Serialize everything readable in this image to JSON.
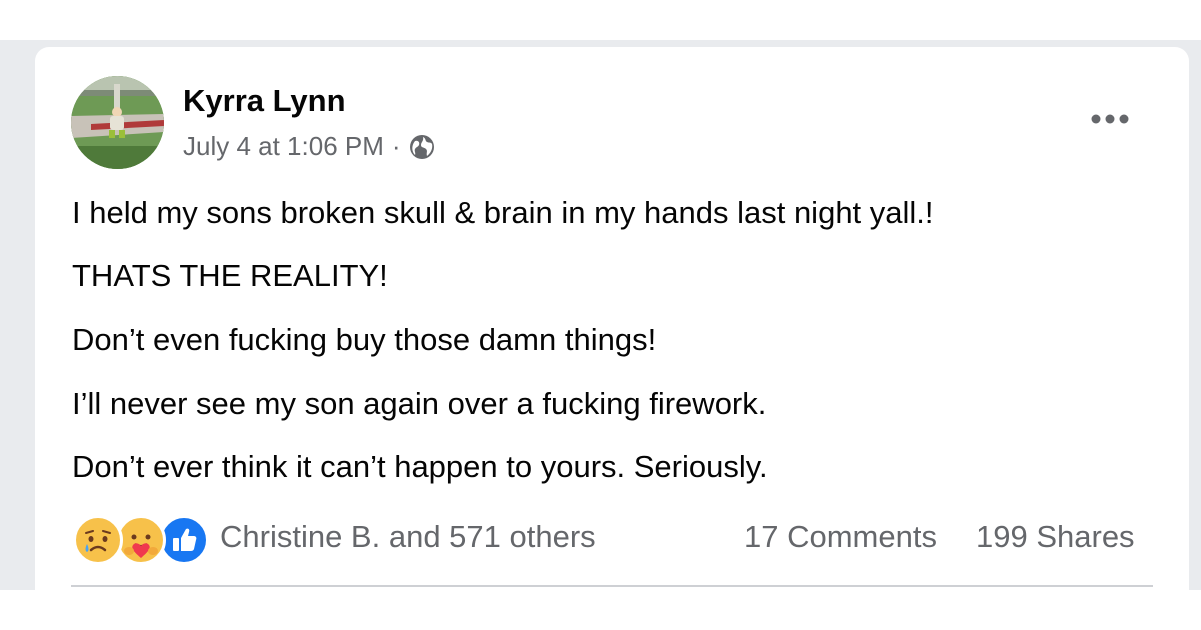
{
  "post": {
    "author": "Kyrra Lynn",
    "timestamp": "July 4 at 1:06 PM",
    "separator": "·",
    "privacy_icon": "globe-icon",
    "more_icon": "more-options-icon",
    "lines": [
      "I held my sons broken skull & brain in my hands last night yall.!",
      "THATS THE REALITY!",
      "Don’t even fucking buy those damn things!",
      "I’ll never see my son again over a fucking firework.",
      "Don’t ever think it can’t happen to yours. Seriously."
    ]
  },
  "footer": {
    "reaction_icons": [
      "sad-reaction-icon",
      "care-reaction-icon",
      "like-reaction-icon"
    ],
    "reactions_text": "Christine B. and 571 others",
    "comments_text": "17 Comments",
    "shares_text": "199 Shares"
  },
  "colors": {
    "text_primary": "#050505",
    "text_secondary": "#65676b",
    "like_blue": "#1877f2",
    "background": "#e9ebee"
  }
}
